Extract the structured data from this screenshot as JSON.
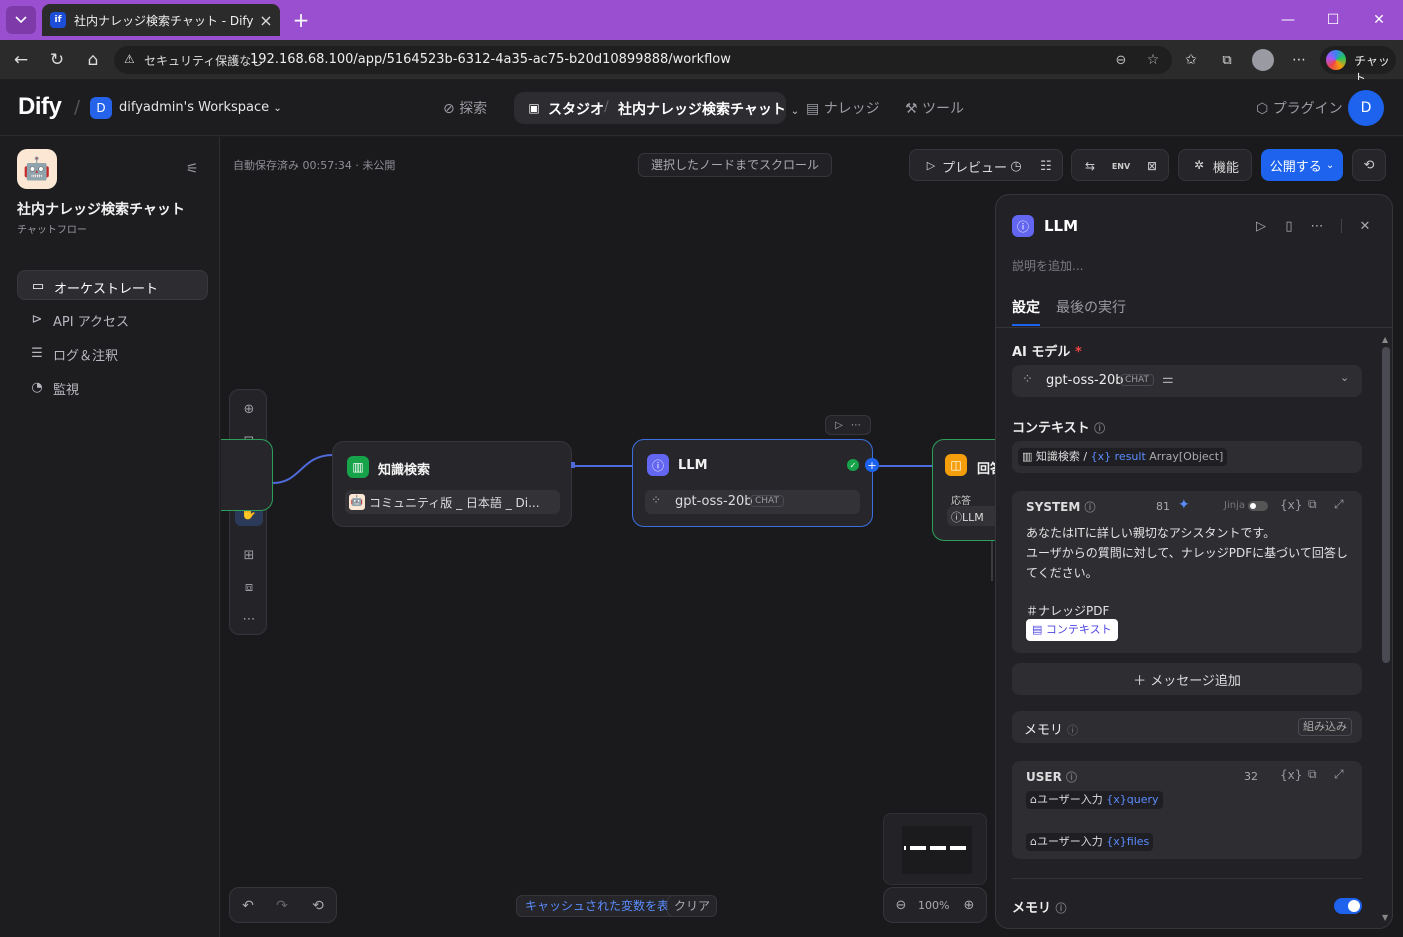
{
  "browser": {
    "tab_title": "社内ナレッジ検索チャット - Dify",
    "security_label": "セキュリティ保護なし",
    "url": "192.168.68.100/app/5164523b-6312-4a35-ac75-b20d10899888/workflow",
    "chat_label": "チャット"
  },
  "header": {
    "logo": "Dify",
    "workspace_badge": "D",
    "workspace_name": "difyadmin's Workspace",
    "nav": {
      "explore": "探索",
      "studio": "スタジオ",
      "app_name": "社内ナレッジ検索チャット",
      "knowledge": "ナレッジ",
      "tools": "ツール",
      "plugins": "プラグイン"
    },
    "avatar": "D"
  },
  "sidebar": {
    "app_name": "社内ナレッジ検索チャット",
    "app_type": "チャットフロー",
    "items": [
      {
        "label": "オーケストレート",
        "icon": "orchestrate-icon",
        "active": true
      },
      {
        "label": "API アクセス",
        "icon": "terminal-icon",
        "active": false
      },
      {
        "label": "ログ＆注釈",
        "icon": "log-icon",
        "active": false
      },
      {
        "label": "監視",
        "icon": "monitor-icon",
        "active": false
      }
    ]
  },
  "toolbar": {
    "autosave": "自動保存済み 00:57:34 · 未公開",
    "scroll_to_node": "選択したノードまでスクロール",
    "preview": "プレビュー",
    "features": "機能",
    "publish": "公開する"
  },
  "nodes": {
    "knowledge": {
      "title": "知識検索",
      "dataset": "コミュニティ版 _ 日本語 _ Di..."
    },
    "llm": {
      "title": "LLM",
      "model": "gpt-oss-20b",
      "model_tag": "CHAT"
    },
    "answer": {
      "title": "回答",
      "label": "応答",
      "ref": "LLM"
    }
  },
  "bottom": {
    "cache_link": "キャッシュされた変数を表示",
    "clear": "クリア",
    "zoom": "100%"
  },
  "panel": {
    "title": "LLM",
    "desc_placeholder": "説明を追加...",
    "tabs": {
      "settings": "設定",
      "last_run": "最後の実行"
    },
    "model_label": "AI モデル",
    "required_mark": "*",
    "model": {
      "name": "gpt-oss-20b",
      "tag": "CHAT"
    },
    "context_label": "コンテキスト",
    "context_value": {
      "node": "知識検索",
      "sep": "/",
      "var_prefix": "{x}",
      "var": "result",
      "type": "Array[Object]"
    },
    "system": {
      "role": "SYSTEM",
      "count": "81",
      "jinja": "Jinja",
      "line1": "あなたはITに詳しい親切なアシスタントです。",
      "line2": "ユーザからの質問に対して、ナレッジPDFに基づいて回答してください。",
      "heading": "＃ナレッジPDF",
      "context_chip": "コンテキスト"
    },
    "add_message": "＋ メッセージ追加",
    "memory_label": "メモリ",
    "memory_builtin": "組み込み",
    "user": {
      "role": "USER",
      "count": "32",
      "var1_node": "ユーザー入力",
      "var1_prefix": "{x}",
      "var1_name": "query",
      "var2_node": "ユーザー入力",
      "var2_prefix": "{x}",
      "var2_name": "files"
    },
    "memory2_label": "メモリ"
  }
}
